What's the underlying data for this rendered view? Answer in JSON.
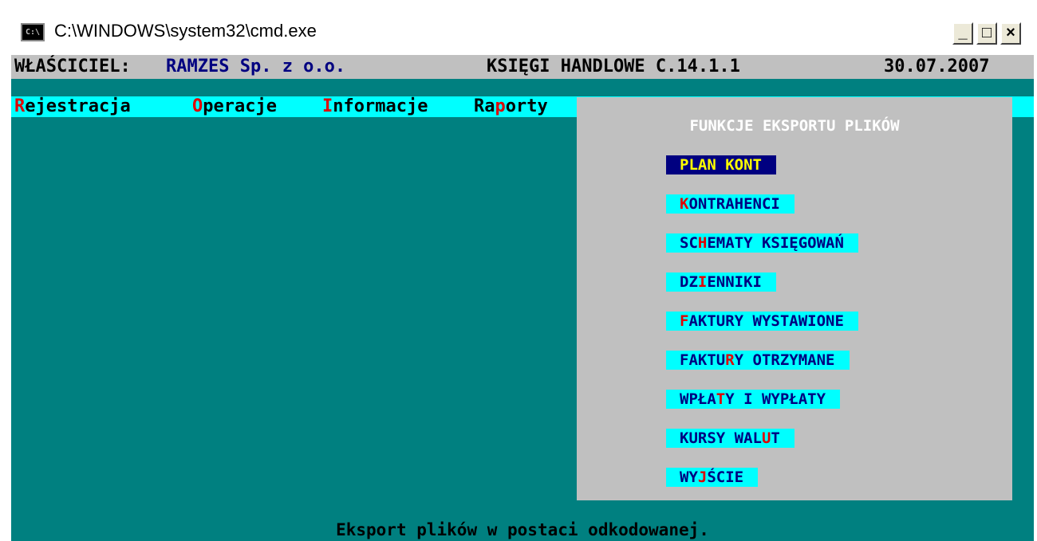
{
  "window": {
    "icon_label": "C:\\",
    "title": "C:\\WINDOWS\\system32\\cmd.exe",
    "min_label": "_",
    "max_label": "□",
    "close_label": "×"
  },
  "header": {
    "owner_label": "WŁAŚCICIEL:",
    "owner_name": "RAMZES Sp. z o.o.",
    "app_name": "KSIĘGI HANDLOWE C.14.1.1",
    "date": "30.07.2007"
  },
  "menu": [
    {
      "hot": "R",
      "rest": "ejestracja"
    },
    {
      "hot": "O",
      "rest": "peracje"
    },
    {
      "hot": "I",
      "rest": "nformacje"
    },
    {
      "pre": "Ra",
      "hot": "p",
      "rest": "orty"
    }
  ],
  "panel": {
    "title": "FUNKCJE EKSPORTU PLIKÓW",
    "options": [
      {
        "pre": "PLAN KONT",
        "hot": "",
        "post": "",
        "selected": true
      },
      {
        "pre": "",
        "hot": "K",
        "post": "ONTRAHENCI",
        "selected": false
      },
      {
        "pre": "SC",
        "hot": "H",
        "post": "EMATY KSIĘGOWAŃ",
        "selected": false
      },
      {
        "pre": "DZ",
        "hot": "I",
        "post": "ENNIKI",
        "selected": false
      },
      {
        "pre": "",
        "hot": "F",
        "post": "AKTURY WYSTAWIONE",
        "selected": false
      },
      {
        "pre": "FAKTU",
        "hot": "R",
        "post": "Y OTRZYMANE",
        "selected": false
      },
      {
        "pre": "WPŁA",
        "hot": "T",
        "post": "Y I WYPŁATY",
        "selected": false
      },
      {
        "pre": "KURSY WAL",
        "hot": "U",
        "post": "T",
        "selected": false
      },
      {
        "pre": "WY",
        "hot": "J",
        "post": "ŚCIE",
        "selected": false
      }
    ]
  },
  "status": "Eksport plików w postaci odkodowanej.",
  "colors": {
    "console_bg": "#008080",
    "header_bg": "#c0c0c0",
    "menu_bg": "#00ffff",
    "hotkey": "#e00000",
    "selected_bg": "#000080",
    "selected_fg": "#ffff00"
  }
}
